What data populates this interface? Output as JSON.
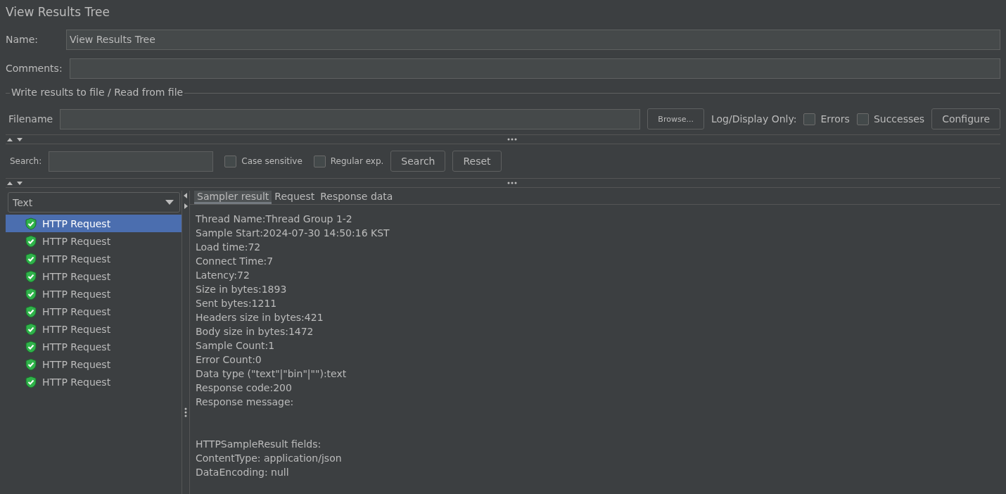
{
  "title": "View Results Tree",
  "name_field": {
    "label": "Name:",
    "value": "View Results Tree"
  },
  "comments_field": {
    "label": "Comments:"
  },
  "file_group": {
    "legend": "Write results to file / Read from file",
    "filename_label": "Filename",
    "browse_button": "Browse...",
    "log_label": "Log/Display Only:",
    "options": [
      {
        "label": "Errors",
        "checked": false
      },
      {
        "label": "Successes",
        "checked": false
      }
    ],
    "configure_button": "Configure"
  },
  "search": {
    "label": "Search:",
    "options": [
      {
        "label": "Case sensitive",
        "checked": false
      },
      {
        "label": "Regular exp.",
        "checked": false
      }
    ],
    "search_button": "Search",
    "reset_button": "Reset"
  },
  "renderer": {
    "value": "Text"
  },
  "samples": [
    {
      "label": "HTTP Request",
      "selected": true
    },
    {
      "label": "HTTP Request",
      "selected": false
    },
    {
      "label": "HTTP Request",
      "selected": false
    },
    {
      "label": "HTTP Request",
      "selected": false
    },
    {
      "label": "HTTP Request",
      "selected": false
    },
    {
      "label": "HTTP Request",
      "selected": false
    },
    {
      "label": "HTTP Request",
      "selected": false
    },
    {
      "label": "HTTP Request",
      "selected": false
    },
    {
      "label": "HTTP Request",
      "selected": false
    },
    {
      "label": "HTTP Request",
      "selected": false
    }
  ],
  "tabs": [
    {
      "label": "Sampler result",
      "selected": true
    },
    {
      "label": "Request",
      "selected": false
    },
    {
      "label": "Response data",
      "selected": false
    }
  ],
  "result_sections": [
    {
      "lines": [
        "Thread Name:Thread Group 1-2",
        "Sample Start:2024-07-30 14:50:16 KST",
        "Load time:72",
        "Connect Time:7",
        "Latency:72",
        "Size in bytes:1893",
        "Sent bytes:1211",
        "Headers size in bytes:421",
        "Body size in bytes:1472",
        "Sample Count:1",
        "Error Count:0",
        "Data type (\"text\"|\"bin\"|\"\"):text",
        "Response code:200",
        "Response message:"
      ]
    },
    {
      "lines": [
        "HTTPSampleResult fields:",
        "ContentType: application/json",
        "DataEncoding: null"
      ]
    }
  ]
}
